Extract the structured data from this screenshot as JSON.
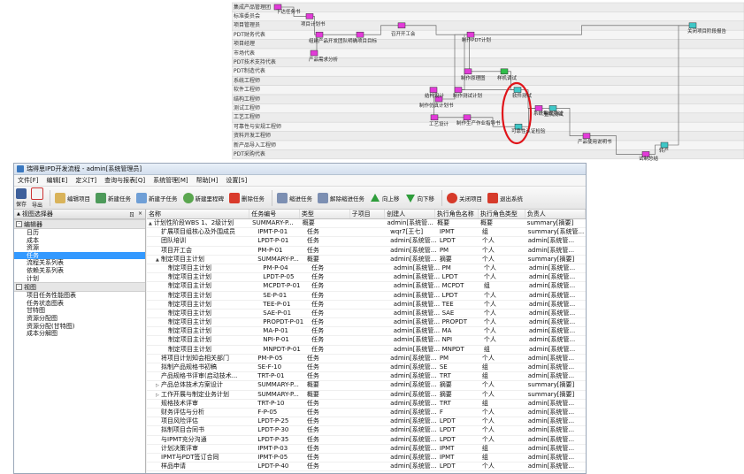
{
  "flow": {
    "lanes": [
      "集成产品管理团",
      "标准委员会",
      "项目管理员",
      "PDT财务代表",
      "项目经理",
      "市场代表",
      "PDT技术支持代表",
      "PDT制造代表",
      "系统工程师",
      "软件工程师",
      "结构工程师",
      "测试工程师",
      "工艺工程师",
      "可靠性与安规工程师",
      "资料开发工程师",
      "新产品导入工程师",
      "PDT采购代表"
    ],
    "nodes": [
      {
        "label": "下达任务书",
        "color": "#e23bd8"
      },
      {
        "label": "项目计划书",
        "color": "#e23bd8"
      },
      {
        "label": "组建产品开发团队",
        "color": "#e23bd8"
      },
      {
        "label": "明确项目目标",
        "color": "#e23bd8"
      },
      {
        "label": "召开开工会",
        "color": "#e23bd8"
      },
      {
        "label": "产品需求分析",
        "color": "#e23bd8"
      },
      {
        "label": "制作PDT计划",
        "color": "#e23bd8"
      },
      {
        "label": "制作仿真计划书",
        "color": "#e23bd8"
      },
      {
        "label": "制作原理图",
        "color": "#e23bd8"
      },
      {
        "label": "样机调试",
        "color": "#2fbf4a"
      },
      {
        "label": "制作测试计划",
        "color": "#e23bd8"
      },
      {
        "label": "软件测试",
        "color": "#3fc7c7"
      },
      {
        "label": "结构设计",
        "color": "#e23bd8"
      },
      {
        "label": "系统集成测试",
        "color": "#e23bd8"
      },
      {
        "label": "整机测试",
        "color": "#3fc7c7"
      },
      {
        "label": "工艺设计",
        "color": "#e23bd8"
      },
      {
        "label": "制作生产作业指导书",
        "color": "#e23bd8"
      },
      {
        "label": "可靠性认证检验",
        "color": "#3fc7c7"
      },
      {
        "label": "产品使用说明书",
        "color": "#e23bd8"
      },
      {
        "label": "试制总结",
        "color": "#e23bd8"
      },
      {
        "label": "转产",
        "color": "#3fc7c7"
      },
      {
        "label": "关闭项目阶段报告",
        "color": "#3fc7c7"
      }
    ]
  },
  "window": {
    "title": "瑞得思IPD开发流程 - admin[系统管理员]",
    "menus": [
      "文件[F]",
      "编辑[E]",
      "定义[T]",
      "查询与报表[Q]",
      "系统管理[M]",
      "帮助[H]",
      "设置[S]"
    ],
    "toolbar": {
      "save": "保存",
      "export": "导出",
      "edit_project": "编辑项目",
      "new_task": "新建任务",
      "new_subtask": "新建子任务",
      "new_milestone": "新建里程碑",
      "delete_task": "删除任务",
      "indent": "缩进任务",
      "outdent": "解除缩进任务",
      "move_up": "向上移",
      "move_down": "向下移",
      "close_project": "关闭项目",
      "exit": "退出系统"
    }
  },
  "leftpane": {
    "title": "视图选择器",
    "pin": "ㄖ",
    "close": "×",
    "editor_group": "编辑器",
    "editor_items": [
      "日历",
      "成本",
      "资源",
      "任务",
      "流程关系列表",
      "依赖关系列表",
      "计划"
    ],
    "selected_index": 3,
    "view_group": "视图",
    "view_items": [
      "项目任务性能图表",
      "任务状态图表",
      "甘特图",
      "资源分配图",
      "资源分配(甘特图)",
      "成本分解图"
    ]
  },
  "grid": {
    "headers": [
      "名称",
      "任务编号",
      "类型",
      "子项目",
      "创建人",
      "执行角色名称",
      "执行角色类型",
      "负责人"
    ],
    "rows": [
      {
        "indent": 0,
        "toggle": "▲",
        "name": "计划性阶段WBS 1、2级计划",
        "code": "SUMMARY-P...",
        "type": "概要",
        "sub": "",
        "creator": "admin[系统管...",
        "role": "概要",
        "rtype": "概要",
        "owner": "summary[摘要]"
      },
      {
        "indent": 1,
        "toggle": "",
        "name": "扩展项目组核心及外围成员",
        "code": "IPMT-P-01",
        "type": "任务",
        "sub": "",
        "creator": "wqr7[王七]",
        "role": "IPMT",
        "rtype": "组",
        "owner": "summary[系统管..."
      },
      {
        "indent": 1,
        "toggle": "",
        "name": "团队培训",
        "code": "LPDT-P-01",
        "type": "任务",
        "sub": "",
        "creator": "admin[系统管...",
        "role": "LPDT",
        "rtype": "个人",
        "owner": "admin[系统管..."
      },
      {
        "indent": 1,
        "toggle": "",
        "name": "项目开工会",
        "code": "PM-P-01",
        "type": "任务",
        "sub": "",
        "creator": "admin[系统管...",
        "role": "PM",
        "rtype": "个人",
        "owner": "admin[系统管..."
      },
      {
        "indent": 1,
        "toggle": "▲",
        "name": "制定项目主计划",
        "code": "SUMMARY-P...",
        "type": "概要",
        "sub": "",
        "creator": "admin[系统管...",
        "role": "摘要",
        "rtype": "个人",
        "owner": "summary[摘要]"
      },
      {
        "indent": 2,
        "toggle": "",
        "name": "制定项目主计划",
        "code": "PM-P-04",
        "type": "任务",
        "sub": "",
        "creator": "admin[系统管...",
        "role": "PM",
        "rtype": "个人",
        "owner": "admin[系统管..."
      },
      {
        "indent": 2,
        "toggle": "",
        "name": "制定项目主计划",
        "code": "LPDT-P-05",
        "type": "任务",
        "sub": "",
        "creator": "admin[系统管...",
        "role": "LPDT",
        "rtype": "个人",
        "owner": "admin[系统管..."
      },
      {
        "indent": 2,
        "toggle": "",
        "name": "制定项目主计划",
        "code": "MCPDT-P-01",
        "type": "任务",
        "sub": "",
        "creator": "admin[系统管...",
        "role": "MCPDT",
        "rtype": "组",
        "owner": "admin[系统管..."
      },
      {
        "indent": 2,
        "toggle": "",
        "name": "制定项目主计划",
        "code": "SE-P-01",
        "type": "任务",
        "sub": "",
        "creator": "admin[系统管...",
        "role": "LPDT",
        "rtype": "个人",
        "owner": "admin[系统管..."
      },
      {
        "indent": 2,
        "toggle": "",
        "name": "制定项目主计划",
        "code": "TEE-P-01",
        "type": "任务",
        "sub": "",
        "creator": "admin[系统管...",
        "role": "TEE",
        "rtype": "个人",
        "owner": "admin[系统管..."
      },
      {
        "indent": 2,
        "toggle": "",
        "name": "制定项目主计划",
        "code": "SAE-P-01",
        "type": "任务",
        "sub": "",
        "creator": "admin[系统管...",
        "role": "SAE",
        "rtype": "个人",
        "owner": "admin[系统管..."
      },
      {
        "indent": 2,
        "toggle": "",
        "name": "制定项目主计划",
        "code": "PROPDT-P-01",
        "type": "任务",
        "sub": "",
        "creator": "admin[系统管...",
        "role": "PROPDT",
        "rtype": "个人",
        "owner": "admin[系统管..."
      },
      {
        "indent": 2,
        "toggle": "",
        "name": "制定项目主计划",
        "code": "MA-P-01",
        "type": "任务",
        "sub": "",
        "creator": "admin[系统管...",
        "role": "MA",
        "rtype": "个人",
        "owner": "admin[系统管..."
      },
      {
        "indent": 2,
        "toggle": "",
        "name": "制定项目主计划",
        "code": "NPI-P-01",
        "type": "任务",
        "sub": "",
        "creator": "admin[系统管...",
        "role": "NPI",
        "rtype": "个人",
        "owner": "admin[系统管..."
      },
      {
        "indent": 2,
        "toggle": "",
        "name": "制定项目主计划",
        "code": "MNPDT-P-01",
        "type": "任务",
        "sub": "",
        "creator": "admin[系统管...",
        "role": "MNPDT",
        "rtype": "组",
        "owner": "admin[系统管..."
      },
      {
        "indent": 1,
        "toggle": "",
        "name": "将项目计划知会相关部门",
        "code": "PM-P-05",
        "type": "任务",
        "sub": "",
        "creator": "admin[系统管...",
        "role": "PM",
        "rtype": "个人",
        "owner": "admin[系统管..."
      },
      {
        "indent": 1,
        "toggle": "",
        "name": "拟制产品规格书初稿",
        "code": "SE-F-10",
        "type": "任务",
        "sub": "",
        "creator": "admin[系统管...",
        "role": "SE",
        "rtype": "组",
        "owner": "admin[系统管..."
      },
      {
        "indent": 1,
        "toggle": "",
        "name": "产品规格书评审(启动技术...",
        "code": "TRT-P-01",
        "type": "任务",
        "sub": "",
        "creator": "admin[系统管...",
        "role": "TRT",
        "rtype": "组",
        "owner": "admin[系统管..."
      },
      {
        "indent": 1,
        "toggle": "▷",
        "name": "产品总体技术方案设计",
        "code": "SUMMARY-P...",
        "type": "概要",
        "sub": "",
        "creator": "admin[系统管...",
        "role": "摘要",
        "rtype": "个人",
        "owner": "summary[摘要]"
      },
      {
        "indent": 1,
        "toggle": "▷",
        "name": "工作开展与制定业务计划",
        "code": "SUMMARY-P...",
        "type": "概要",
        "sub": "",
        "creator": "admin[系统管...",
        "role": "摘要",
        "rtype": "个人",
        "owner": "summary[摘要]"
      },
      {
        "indent": 1,
        "toggle": "",
        "name": "规格技术评审",
        "code": "TRT-P-10",
        "type": "任务",
        "sub": "",
        "creator": "admin[系统管...",
        "role": "TRT",
        "rtype": "组",
        "owner": "admin[系统管..."
      },
      {
        "indent": 1,
        "toggle": "",
        "name": "财务评估与分析",
        "code": "F-P-05",
        "type": "任务",
        "sub": "",
        "creator": "admin[系统管...",
        "role": "F",
        "rtype": "个人",
        "owner": "admin[系统管..."
      },
      {
        "indent": 1,
        "toggle": "",
        "name": "项目风险评估",
        "code": "LPDT-P-25",
        "type": "任务",
        "sub": "",
        "creator": "admin[系统管...",
        "role": "LPDT",
        "rtype": "个人",
        "owner": "admin[系统管..."
      },
      {
        "indent": 1,
        "toggle": "",
        "name": "拟制项目合同书",
        "code": "LPDT-P-30",
        "type": "任务",
        "sub": "",
        "creator": "admin[系统管...",
        "role": "LPDT",
        "rtype": "个人",
        "owner": "admin[系统管..."
      },
      {
        "indent": 1,
        "toggle": "",
        "name": "与IPMT充分沟通",
        "code": "LPDT-P-35",
        "type": "任务",
        "sub": "",
        "creator": "admin[系统管...",
        "role": "LPDT",
        "rtype": "个人",
        "owner": "admin[系统管..."
      },
      {
        "indent": 1,
        "toggle": "",
        "name": "计划决策评审",
        "code": "IPMT-P-03",
        "type": "任务",
        "sub": "",
        "creator": "admin[系统管...",
        "role": "IPMT",
        "rtype": "组",
        "owner": "admin[系统管..."
      },
      {
        "indent": 1,
        "toggle": "",
        "name": "IPMT与PDT签订合同",
        "code": "IPMT-P-05",
        "type": "任务",
        "sub": "",
        "creator": "admin[系统管...",
        "role": "IPMT",
        "rtype": "组",
        "owner": "admin[系统管..."
      },
      {
        "indent": 1,
        "toggle": "",
        "name": "样品申请",
        "code": "LPDT-P-40",
        "type": "任务",
        "sub": "",
        "creator": "admin[系统管...",
        "role": "LPDT",
        "rtype": "个人",
        "owner": "admin[系统管..."
      }
    ]
  }
}
